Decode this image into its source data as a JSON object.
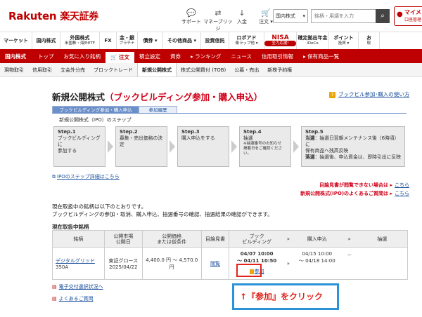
{
  "header": {
    "logo_en": "Rakuten",
    "logo_jp": "楽天証券",
    "icons": [
      {
        "name": "support-icon",
        "glyph": "💬",
        "label": "サポート"
      },
      {
        "name": "money-bridge-icon",
        "glyph": "⇄",
        "label": "マネーブリッジ"
      },
      {
        "name": "deposit-icon",
        "glyph": "↓",
        "label": "入金"
      },
      {
        "name": "cart-icon",
        "glyph": "🛒",
        "label": "注文",
        "suffix": "▾"
      }
    ],
    "market_select": "国内株式",
    "search_placeholder": "銘柄・用語を入力",
    "mypage_label": "マイメ",
    "mypage_sub": "口座管理"
  },
  "category_nav": [
    {
      "label": "マーケット",
      "width": 46
    },
    {
      "label": "国内株式",
      "width": 40
    },
    {
      "label": "外国株式",
      "sub": "米国株・海外ETF",
      "width": 56
    },
    {
      "label": "FX",
      "width": 24
    },
    {
      "label": "金・銀",
      "sub": "プラチナ",
      "width": 30
    },
    {
      "label": "債券",
      "suffix": "▾",
      "width": 36
    },
    {
      "label": "その他商品",
      "suffix": "▾",
      "width": 54
    },
    {
      "label": "投資信託",
      "width": 40
    },
    {
      "label": "ロボアド",
      "sub": "楽ラップ他",
      "suffix": "▾",
      "width": 50
    },
    {
      "label": "NISA",
      "sub": "全力応援!",
      "nisa": true,
      "width": 46
    },
    {
      "label": "確定拠出年金",
      "sub": "iDeCo",
      "width": 46
    },
    {
      "label": "ポイント",
      "sub": "投資",
      "suffix": "▾",
      "width": 42
    },
    {
      "label": "お",
      "sub": "取",
      "width": 30
    }
  ],
  "red_nav": [
    {
      "label": "国内株式",
      "active": false
    },
    {
      "label": "トップ",
      "active": false
    },
    {
      "label": "お気に入り銘柄",
      "active": false
    },
    {
      "label": "🛒 注文",
      "active": true
    },
    {
      "label": "積立設定",
      "active": false
    },
    {
      "label": "資券",
      "active": false
    },
    {
      "label": "▸ ランキング",
      "active": false
    },
    {
      "label": "ニュース",
      "active": false
    },
    {
      "label": "信用取引情報",
      "active": false
    },
    {
      "label": "▸ 保有商品一覧",
      "active": false
    }
  ],
  "gray_nav": [
    {
      "label": "現物取引",
      "active": false
    },
    {
      "label": "信用取引",
      "active": false
    },
    {
      "label": "立会外分売",
      "active": false
    },
    {
      "label": "ブロックトレード",
      "active": false
    },
    {
      "label": "新規公開株式",
      "active": true
    },
    {
      "label": "株式公開買付 (TOB)",
      "active": false
    },
    {
      "label": "公募・売出",
      "active": false
    },
    {
      "label": "新株予約権",
      "active": false
    }
  ],
  "page": {
    "title_black": "新規公開株式",
    "title_red": "（ブックビルディング参加・購入申込）",
    "howto_label": "ブックビル参加･購入の使い方",
    "tabs": [
      {
        "label": "ブックビルディング参加・購入申込",
        "active": true
      },
      {
        "label": "参加履歴",
        "active": false
      }
    ],
    "steps_caption": "新規公開株式（IPO）のステップ",
    "steps": [
      {
        "title": "Step.1",
        "lines": [
          "ブックビルディングに",
          "参加する"
        ]
      },
      {
        "title": "Step.2",
        "lines": [
          "募集・売出価格の決",
          "定"
        ]
      },
      {
        "title": "Step.3",
        "lines": [
          "購入申込をする"
        ]
      },
      {
        "title": "Step.4",
        "lines": [
          "抽選"
        ],
        "small": [
          "※抽選番号のお知らせ",
          "掲載日をご確認ください。"
        ]
      },
      {
        "title": "Step.5",
        "lines": [
          "当選：抽選日翌朝メンテナンス後（6時頃）に",
          "保有商品へ残高反映",
          "落選：抽選後、申込資金は、即時引出に反映"
        ],
        "em_prefixes": [
          "当選",
          "落選"
        ]
      }
    ],
    "step_detail_link": "IPOのステップ詳細はこちら",
    "right_link1_text": "目論見書が閲覧できない場合は",
    "right_link1_link": "こちら",
    "right_link2_text": "新規公開株式(IPO)のよくあるご質問は",
    "right_link2_link": "こちら",
    "intro_line1": "現在取扱中の銘柄は以下のとおりです。",
    "intro_line2": "ブックビルディングの参加・取消、購入申込、抽選番号の確認、抽選結果の確認ができます。",
    "listing_heading": "現在取扱中銘柄",
    "table": {
      "headers": {
        "name": "銘柄",
        "market_1": "公開市場",
        "market_2": "公開日",
        "price_1": "公開価格",
        "price_2": "または仮条件",
        "prospectus": "目論見書",
        "bb_1": "ブック",
        "bb_2": "ビルディング",
        "purchase": "購入申込",
        "lottery": "抽選",
        "arrow": "»"
      },
      "row": {
        "name": "デジタルグリッド",
        "code": "350A",
        "market": "東証グロース",
        "listing_date": "2025/04/22",
        "price": "4,400.0 円 ～ 4,570.0 円",
        "prospectus": "閲覧",
        "bb_start": "04/07 10:00",
        "bb_end": "～ 04/11 10:50",
        "apply_label": "参加",
        "purchase_start": "04/15 10:00",
        "purchase_end": "～ 04/18 14:00",
        "lottery": "－",
        "arrow": "»"
      }
    },
    "ekoufu_link": "電子交付選択状況へ",
    "faq_link": "よくあるご質問",
    "callout": "↑『参加』をクリック"
  },
  "colors": {
    "brand_red": "#bf0000",
    "link_blue": "#1a4f9c",
    "callout_border": "#2b92d8",
    "highlight_red": "#e2231a"
  }
}
